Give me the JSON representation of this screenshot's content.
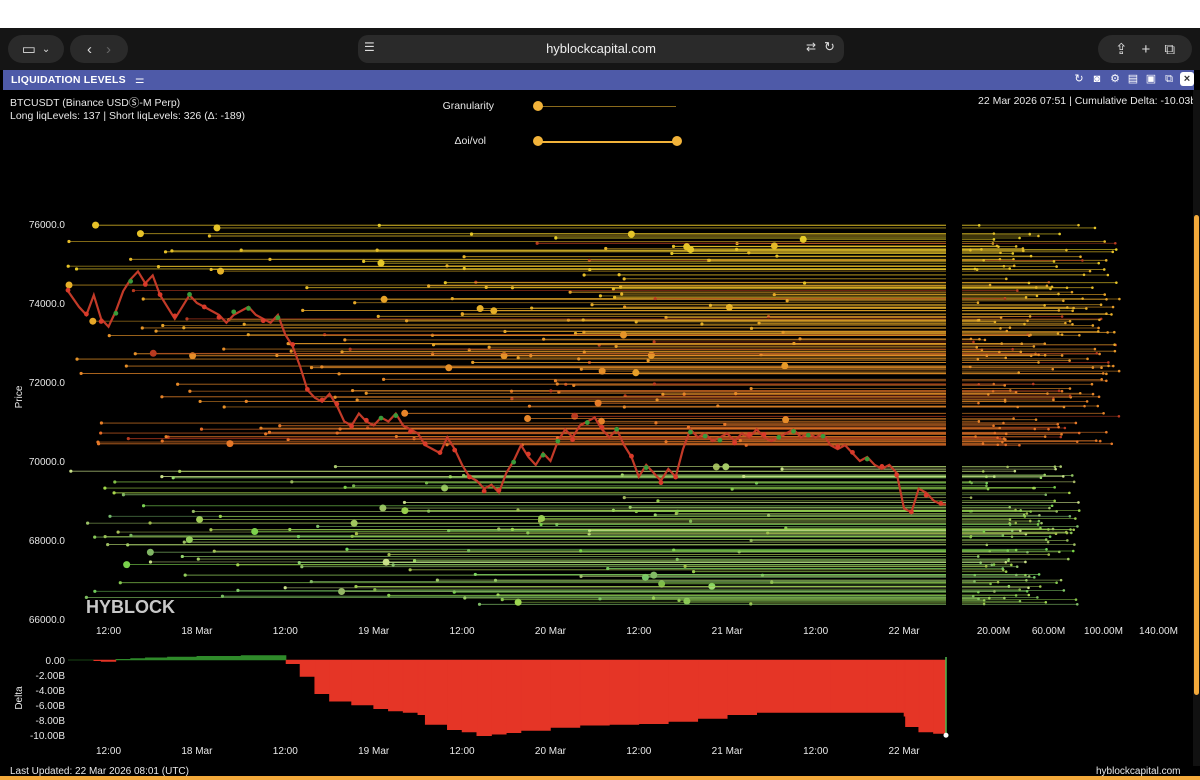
{
  "browser": {
    "url": "hyblockcapital.com"
  },
  "panel": {
    "title": "LIQUIDATION LEVELS"
  },
  "info": {
    "symbol": "BTCUSDT (Binance USDⓈ-M Perp)",
    "levels": "Long liqLevels: 137 | Short liqLevels: 326 (Δ: -189)",
    "timestamp": "22 Mar 2026 07:51 | Cumulative Delta: -10.03b"
  },
  "controls": {
    "granularity_label": "Granularity",
    "granularity_value": 0.0,
    "oi_vol_label": "Δoi/vol",
    "oi_vol_range": [
      0.0,
      1.0
    ]
  },
  "watermark": "HYBLOCK",
  "chart_data": [
    {
      "type": "line",
      "name": "price",
      "ylabel": "Price",
      "ylim": [
        66000,
        76500
      ],
      "y_ticks": [
        "76000.0",
        "74000.0",
        "72000.0",
        "70000.0",
        "68000.0",
        "66000.0"
      ],
      "y_tick_values": [
        76000,
        74000,
        72000,
        70000,
        68000,
        66000
      ],
      "x_ticks": [
        "12:00",
        "18 Mar",
        "12:00",
        "19 Mar",
        "12:00",
        "20 Mar",
        "12:00",
        "21 Mar",
        "12:00",
        "22 Mar"
      ],
      "x_tick_hours": [
        12,
        24,
        36,
        48,
        60,
        72,
        84,
        96,
        108,
        120
      ],
      "x_range_hours": [
        6.5,
        125.7
      ],
      "price_points": [
        [
          6.5,
          74300
        ],
        [
          8,
          73900
        ],
        [
          9,
          73700
        ],
        [
          10,
          74200
        ],
        [
          11,
          73600
        ],
        [
          12,
          73400
        ],
        [
          13,
          73800
        ],
        [
          14,
          74300
        ],
        [
          15,
          74600
        ],
        [
          16,
          74800
        ],
        [
          17,
          74500
        ],
        [
          18,
          74700
        ],
        [
          19,
          74200
        ],
        [
          20,
          73900
        ],
        [
          21,
          73600
        ],
        [
          22,
          73900
        ],
        [
          23,
          74200
        ],
        [
          24,
          74000
        ],
        [
          25,
          73900
        ],
        [
          26,
          73800
        ],
        [
          27,
          73700
        ],
        [
          28,
          73500
        ],
        [
          29,
          73700
        ],
        [
          30,
          73800
        ],
        [
          31,
          73900
        ],
        [
          32,
          73700
        ],
        [
          33,
          73600
        ],
        [
          34,
          73500
        ],
        [
          35,
          73700
        ],
        [
          36,
          73200
        ],
        [
          37,
          72900
        ],
        [
          38,
          72400
        ],
        [
          39,
          71800
        ],
        [
          40,
          71600
        ],
        [
          41,
          71500
        ],
        [
          42,
          71700
        ],
        [
          43,
          71400
        ],
        [
          44,
          71000
        ],
        [
          45,
          70900
        ],
        [
          46,
          71200
        ],
        [
          47,
          71000
        ],
        [
          48,
          70900
        ],
        [
          49,
          71100
        ],
        [
          50,
          71000
        ],
        [
          51,
          71200
        ],
        [
          52,
          70900
        ],
        [
          53,
          70800
        ],
        [
          54,
          70700
        ],
        [
          55,
          70400
        ],
        [
          56,
          70300
        ],
        [
          57,
          70200
        ],
        [
          58,
          70600
        ],
        [
          59,
          70300
        ],
        [
          60,
          69900
        ],
        [
          61,
          69600
        ],
        [
          62,
          69500
        ],
        [
          63,
          69300
        ],
        [
          64,
          69400
        ],
        [
          65,
          69200
        ],
        [
          66,
          69700
        ],
        [
          67,
          70000
        ],
        [
          68,
          70400
        ],
        [
          69,
          70100
        ],
        [
          70,
          69900
        ],
        [
          71,
          70200
        ],
        [
          72,
          70000
        ],
        [
          73,
          70500
        ],
        [
          74,
          70800
        ],
        [
          75,
          70600
        ],
        [
          76,
          70900
        ],
        [
          77,
          71000
        ],
        [
          78,
          71100
        ],
        [
          79,
          70800
        ],
        [
          80,
          70600
        ],
        [
          81,
          70800
        ],
        [
          82,
          70400
        ],
        [
          83,
          70100
        ],
        [
          84,
          69600
        ],
        [
          85,
          69900
        ],
        [
          86,
          69700
        ],
        [
          87,
          69500
        ],
        [
          88,
          69800
        ],
        [
          89,
          69600
        ],
        [
          90,
          70300
        ],
        [
          91,
          70800
        ],
        [
          92,
          70600
        ],
        [
          93,
          70700
        ],
        [
          94,
          70500
        ],
        [
          95,
          70600
        ],
        [
          96,
          70700
        ],
        [
          97,
          70500
        ],
        [
          98,
          70700
        ],
        [
          99,
          70600
        ],
        [
          100,
          70800
        ],
        [
          101,
          70600
        ],
        [
          102,
          70500
        ],
        [
          103,
          70600
        ],
        [
          104,
          70700
        ],
        [
          105,
          70800
        ],
        [
          106,
          70600
        ],
        [
          107,
          70700
        ],
        [
          108,
          70600
        ],
        [
          109,
          70700
        ],
        [
          110,
          70400
        ],
        [
          111,
          70300
        ],
        [
          112,
          70400
        ],
        [
          113,
          70200
        ],
        [
          114,
          70000
        ],
        [
          115,
          70100
        ],
        [
          116,
          69900
        ],
        [
          117,
          69800
        ],
        [
          118,
          69900
        ],
        [
          119,
          69700
        ],
        [
          120,
          68800
        ],
        [
          121,
          68700
        ],
        [
          122,
          69300
        ],
        [
          123,
          69200
        ],
        [
          124,
          69000
        ],
        [
          125,
          68900
        ],
        [
          125.7,
          68900
        ]
      ],
      "liquidation_levels": [
        {
          "side": "short",
          "price_range": [
            70400,
            76000
          ],
          "color": "#e8c23a"
        },
        {
          "side": "long",
          "price_range": [
            66300,
            70000
          ],
          "color": "#8fd068"
        }
      ]
    },
    {
      "type": "bar",
      "name": "volume-profile",
      "x_ticks": [
        "20.00M",
        "60.00M",
        "100.00M",
        "140.00M"
      ],
      "x_tick_values": [
        20,
        60,
        100,
        140
      ],
      "xlim": [
        0,
        160
      ]
    },
    {
      "type": "area",
      "name": "delta",
      "ylabel": "Delta",
      "ylim": [
        -10.4,
        0.6
      ],
      "y_ticks": [
        "0.00",
        "-2.00B",
        "-4.00B",
        "-6.00B",
        "-8.00B",
        "-10.00B"
      ],
      "y_tick_values": [
        0,
        -2,
        -4,
        -6,
        -8,
        -10
      ],
      "x_ticks": [
        "12:00",
        "18 Mar",
        "12:00",
        "19 Mar",
        "12:00",
        "20 Mar",
        "12:00",
        "21 Mar",
        "12:00",
        "22 Mar"
      ],
      "x_tick_hours": [
        12,
        24,
        36,
        48,
        60,
        72,
        84,
        96,
        108,
        120
      ],
      "delta_points": [
        [
          6.5,
          0
        ],
        [
          9,
          0
        ],
        [
          10,
          -0.1
        ],
        [
          11,
          -0.2
        ],
        [
          13,
          0.1
        ],
        [
          15,
          0.2
        ],
        [
          17,
          0.3
        ],
        [
          20,
          0.4
        ],
        [
          24,
          0.5
        ],
        [
          30,
          0.6
        ],
        [
          36,
          0.6
        ],
        [
          36.1,
          -0.5
        ],
        [
          38,
          -2.2
        ],
        [
          40,
          -4.5
        ],
        [
          42,
          -5.5
        ],
        [
          45,
          -6.0
        ],
        [
          48,
          -6.5
        ],
        [
          50,
          -6.8
        ],
        [
          52,
          -7.0
        ],
        [
          54,
          -7.3
        ],
        [
          55,
          -8.6
        ],
        [
          58,
          -9.3
        ],
        [
          60,
          -9.6
        ],
        [
          62,
          -10.1
        ],
        [
          64,
          -9.9
        ],
        [
          66,
          -9.7
        ],
        [
          68,
          -9.4
        ],
        [
          72,
          -9.0
        ],
        [
          76,
          -8.7
        ],
        [
          80,
          -8.6
        ],
        [
          84,
          -8.5
        ],
        [
          88,
          -8.2
        ],
        [
          92,
          -7.8
        ],
        [
          96,
          -7.3
        ],
        [
          100,
          -7.0
        ],
        [
          105,
          -7.0
        ],
        [
          110,
          -7.0
        ],
        [
          115,
          -7.0
        ],
        [
          119,
          -7.0
        ],
        [
          120,
          -7.5
        ],
        [
          120.2,
          -8.9
        ],
        [
          122,
          -9.6
        ],
        [
          124,
          -9.8
        ],
        [
          125.5,
          -10.0
        ],
        [
          125.7,
          -10.03
        ]
      ]
    }
  ],
  "footer": {
    "last_updated": "Last Updated: 22 Mar 2026 08:01 (UTC)",
    "site": "hyblockcapital.com"
  },
  "colors": {
    "accent": "#f2a93b",
    "header": "#4e5aa8",
    "delta_negative": "#e53526",
    "delta_positive": "#2f8a2a",
    "candle_up": "#3a9a3a",
    "candle_down": "#d93a2a"
  }
}
